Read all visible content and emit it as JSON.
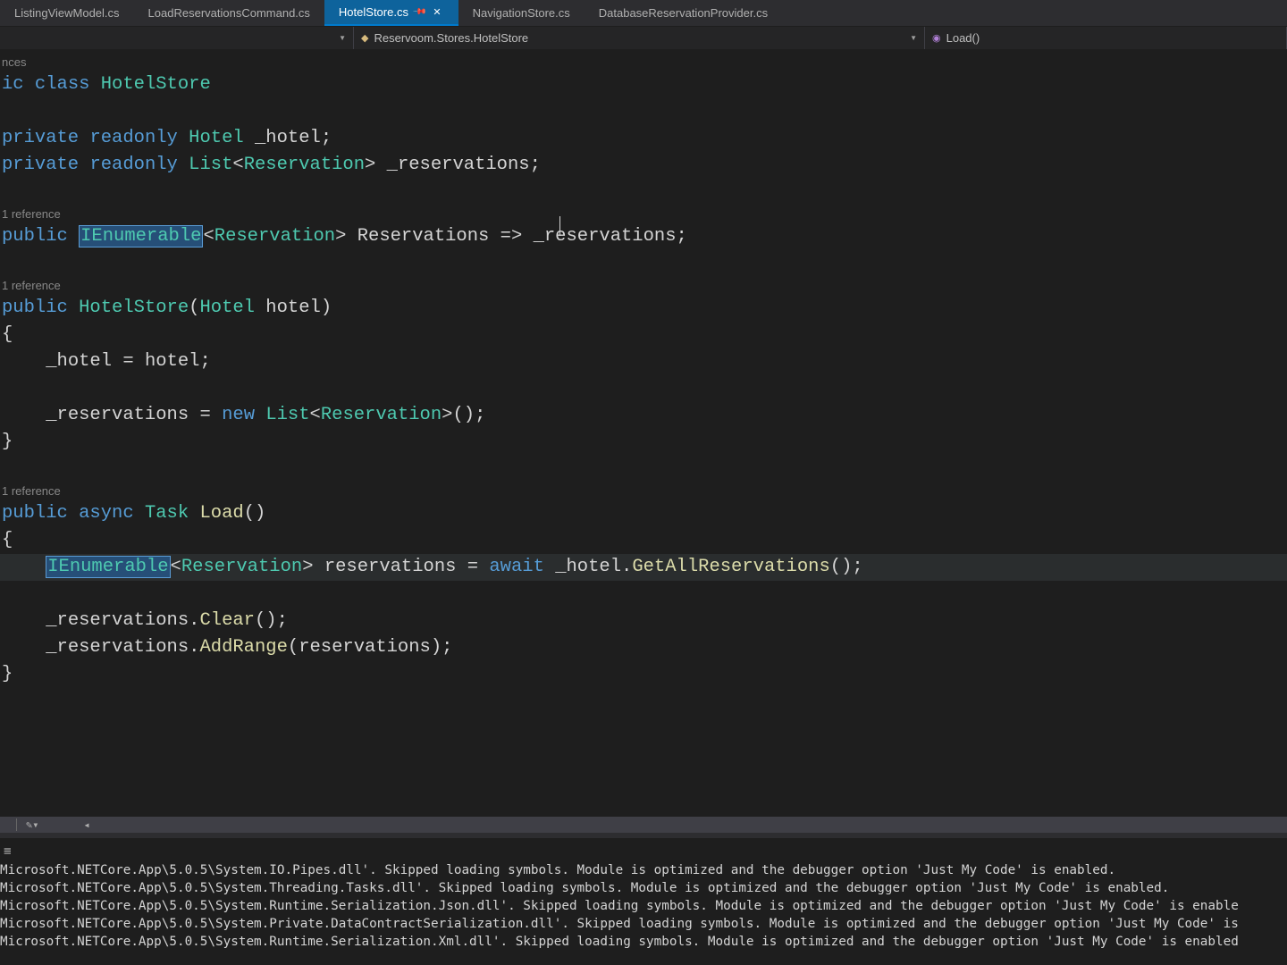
{
  "tabs": [
    {
      "label": "ListingViewModel.cs"
    },
    {
      "label": "LoadReservationsCommand.cs"
    },
    {
      "label": "HotelStore.cs",
      "active": true
    },
    {
      "label": "NavigationStore.cs"
    },
    {
      "label": "DatabaseReservationProvider.cs"
    }
  ],
  "breadcrumb": {
    "namespace": "Reservoom.Stores.HotelStore",
    "member": "Load()"
  },
  "codelens": {
    "class": "nces",
    "prop": "1 reference",
    "ctor": "1 reference",
    "load": "1 reference"
  },
  "code": {
    "kw_public": "public",
    "kw_private": "private",
    "kw_readonly": "readonly",
    "kw_class": "class",
    "kw_async": "async",
    "kw_new": "new",
    "kw_await": "await",
    "type_hotel": "Hotel",
    "type_list": "List",
    "type_reservation": "Reservation",
    "type_ienumerable": "IEnumerable",
    "type_task": "Task",
    "type_hotelstore": "HotelStore",
    "fld_hotel": "_hotel",
    "fld_reservations": "_reservations",
    "prop_reservations": "Reservations",
    "param_hotel": "hotel",
    "var_reservations": "reservations",
    "method_load": "Load",
    "method_clear": "Clear",
    "method_addrange": "AddRange",
    "method_getall": "GetAllReservations",
    "arrow": "=>",
    "ic": "ic"
  },
  "output": {
    "lines": [
      "Microsoft.NETCore.App\\5.0.5\\System.IO.Pipes.dll'. Skipped loading symbols. Module is optimized and the debugger option 'Just My Code' is enabled.",
      "Microsoft.NETCore.App\\5.0.5\\System.Threading.Tasks.dll'. Skipped loading symbols. Module is optimized and the debugger option 'Just My Code' is enabled.",
      "Microsoft.NETCore.App\\5.0.5\\System.Runtime.Serialization.Json.dll'. Skipped loading symbols. Module is optimized and the debugger option 'Just My Code' is enable",
      "Microsoft.NETCore.App\\5.0.5\\System.Private.DataContractSerialization.dll'. Skipped loading symbols. Module is optimized and the debugger option 'Just My Code' is",
      "Microsoft.NETCore.App\\5.0.5\\System.Runtime.Serialization.Xml.dll'. Skipped loading symbols. Module is optimized and the debugger option 'Just My Code' is enabled"
    ]
  }
}
